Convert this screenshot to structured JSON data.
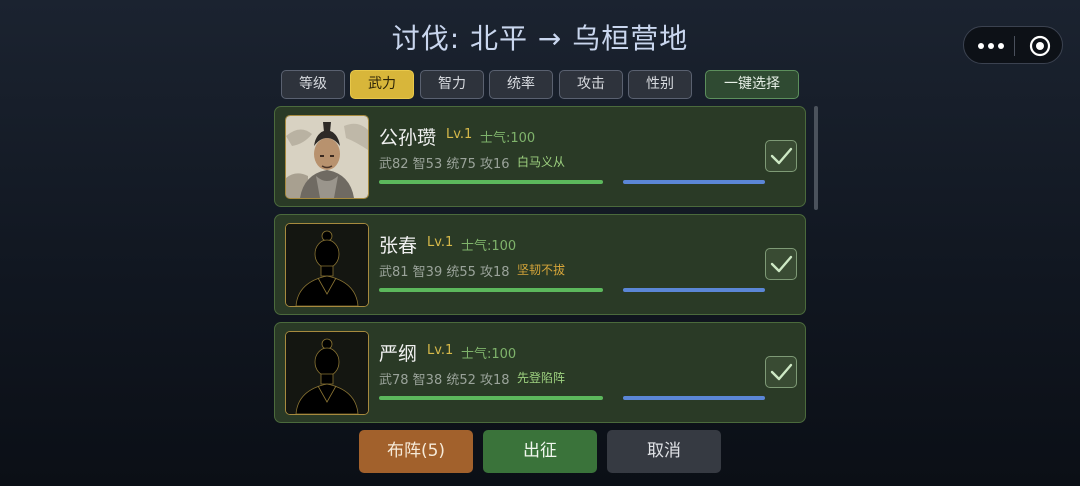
{
  "header": {
    "title": "讨伐: 北平 → 乌桓营地"
  },
  "menu_capsule": {
    "more_icon": "more-dots-icon",
    "close_icon": "target-circle-icon"
  },
  "sort_tabs": [
    {
      "label": "等级",
      "active": false
    },
    {
      "label": "武力",
      "active": true
    },
    {
      "label": "智力",
      "active": false
    },
    {
      "label": "统率",
      "active": false
    },
    {
      "label": "攻击",
      "active": false
    },
    {
      "label": "性别",
      "active": false
    }
  ],
  "select_all_label": "一键选择",
  "generals": [
    {
      "name": "公孙瓒",
      "level": "Lv.1",
      "morale": "士气:100",
      "stats": "武82 智53 统75 攻16",
      "skill": "白马义从",
      "skill_color": "#9dd17f",
      "portrait": "illustrated-general-portrait",
      "checked": true
    },
    {
      "name": "张春",
      "level": "Lv.1",
      "morale": "士气:100",
      "stats": "武81 智39 统55 攻18",
      "skill": "坚韧不拔",
      "skill_color": "#d6a53a",
      "portrait": "silhouette-portrait",
      "checked": true
    },
    {
      "name": "严纲",
      "level": "Lv.1",
      "morale": "士气:100",
      "stats": "武78 智38 统52 攻18",
      "skill": "先登陷阵",
      "skill_color": "#9dd17f",
      "portrait": "silhouette-portrait",
      "checked": true
    }
  ],
  "actions": {
    "formation_label": "布阵(5)",
    "depart_label": "出征",
    "cancel_label": "取消"
  },
  "colors": {
    "active_tab": "#d8b63a",
    "hp_bar": "#5cb85c",
    "mp_bar": "#5b86d6",
    "card_bg": "#2a3a26"
  }
}
